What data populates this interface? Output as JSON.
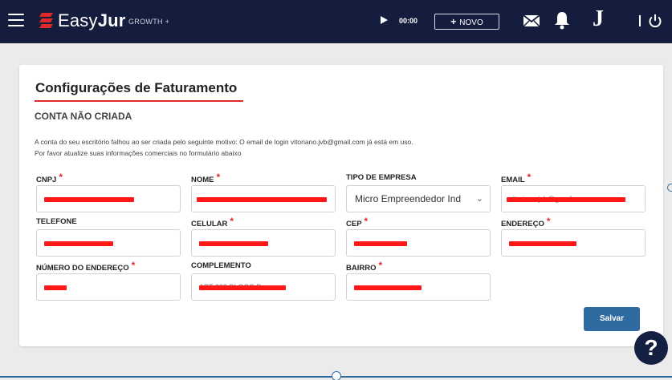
{
  "topbar": {
    "brand_prefix": "Easy",
    "brand_bold": "Jur",
    "plan": "GROWTH +",
    "timer": "00:00",
    "novo_label": "NOVO",
    "avatar_letter": "J"
  },
  "page": {
    "title": "Configurações de Faturamento",
    "status": "CONTA NÃO CRIADA",
    "message_line1": "A conta do seu escritório falhou ao ser criada pelo seguinte motivo: O email de login vitoriano.jvb@gmail.com já está em uso.",
    "message_line2": "Por favor atualize suas informações comerciais no formulário abaixo"
  },
  "fields": {
    "cnpj": {
      "label": "CNPJ",
      "required": "*"
    },
    "nome": {
      "label": "NOME",
      "required": "*"
    },
    "tipo": {
      "label": "TIPO DE EMPRESA",
      "value": "Micro Empreendedor Ind"
    },
    "email": {
      "label": "EMAIL",
      "required": "*",
      "value": "vitoriano.jvb@gmail.com"
    },
    "telefone": {
      "label": "TELEFONE"
    },
    "celular": {
      "label": "CELULAR",
      "required": "*"
    },
    "cep": {
      "label": "CEP",
      "required": "*"
    },
    "endereco": {
      "label": "ENDEREÇO",
      "required": "*"
    },
    "numero": {
      "label": "NÚMERO DO ENDEREÇO",
      "required": "*"
    },
    "complemento": {
      "label": "COMPLEMENTO",
      "value": "APT 302 BLOCO B"
    },
    "bairro": {
      "label": "BAIRRO",
      "required": "*"
    }
  },
  "actions": {
    "save_label": "Salvar",
    "help_label": "?"
  },
  "colors": {
    "topbar": "#141d3d",
    "accent_red": "#e02a2a",
    "save_blue": "#2f6aa0"
  }
}
